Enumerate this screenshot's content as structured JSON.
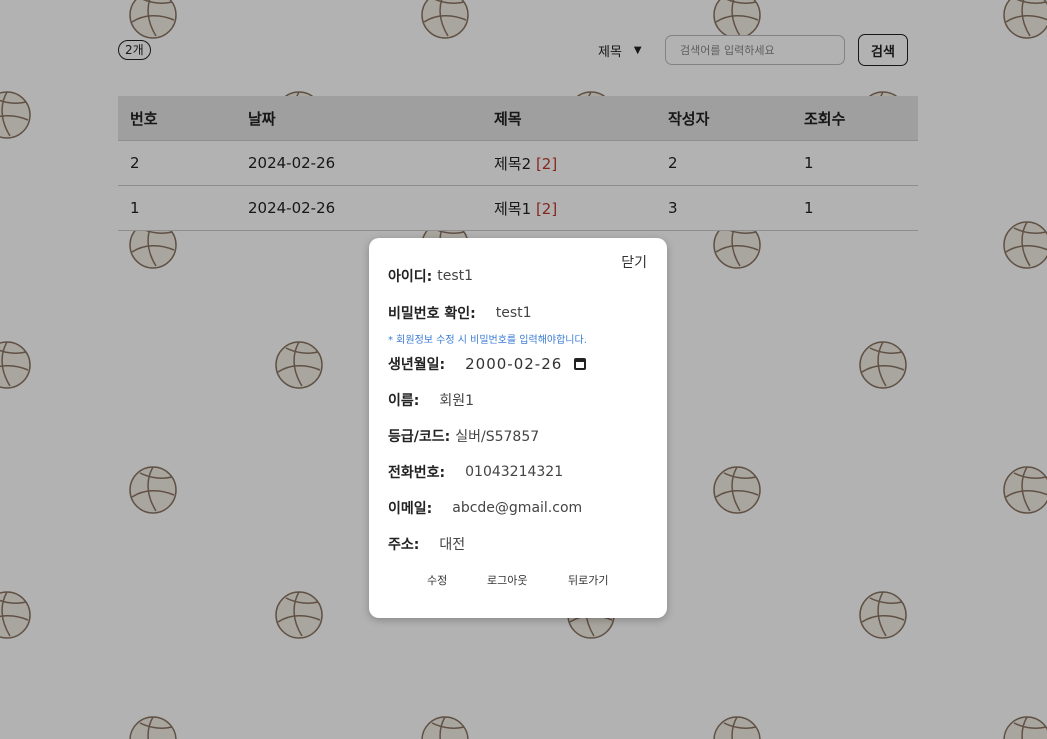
{
  "colors": {
    "comment_count": "#c0392b",
    "hint_text": "#3a7bd5",
    "header_bg": "#e4e4e4"
  },
  "background_pattern_icon": "volleyball-icon",
  "board": {
    "count_badge": "2개",
    "search_select_value": "제목",
    "search_placeholder": "검색어를 입력하세요",
    "search_button": "검색",
    "columns": [
      "번호",
      "날짜",
      "제목",
      "작성자",
      "조회수"
    ],
    "rows": [
      {
        "num": "2",
        "date": "2024-02-26",
        "title": "제목2",
        "comments": "[2]",
        "writer": "2",
        "views": "1"
      },
      {
        "num": "1",
        "date": "2024-02-26",
        "title": "제목1",
        "comments": "[2]",
        "writer": "3",
        "views": "1"
      }
    ]
  },
  "modal": {
    "close_label": "닫기",
    "id_label": "아이디:",
    "id_value": "test1",
    "password_confirm_label": "비밀번호 확인:",
    "password_confirm_value": "test1",
    "password_hint": "* 회원정보 수정 시 비밀번호를 입력해야합니다.",
    "birth_label": "생년월일:",
    "birth_value": "2000-02-26",
    "name_label": "이름:",
    "name_value": "회원1",
    "grade_label": "등급/코드:",
    "grade_value": "실버/S57857",
    "phone_label": "전화번호:",
    "phone_value": "01043214321",
    "email_label": "이메일:",
    "email_value": "abcde@gmail.com",
    "address_label": "주소:",
    "address_value": "대전",
    "edit_button": "수정",
    "logout_button": "로그아웃",
    "back_button": "뒤로가기"
  }
}
